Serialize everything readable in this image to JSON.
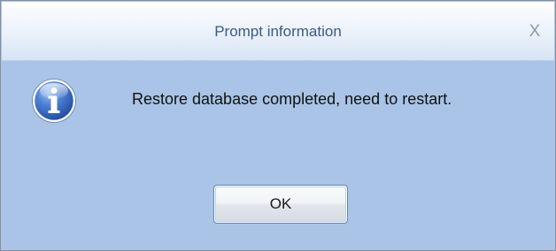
{
  "dialog": {
    "title": "Prompt information",
    "close_label": "X",
    "icon": "info-icon",
    "message": "Restore database completed, need to restart.",
    "ok_label": "OK"
  },
  "colors": {
    "body_background": "#a9c4e6",
    "title_text": "#3b5a84",
    "icon_blue": "#2f5fb8"
  }
}
